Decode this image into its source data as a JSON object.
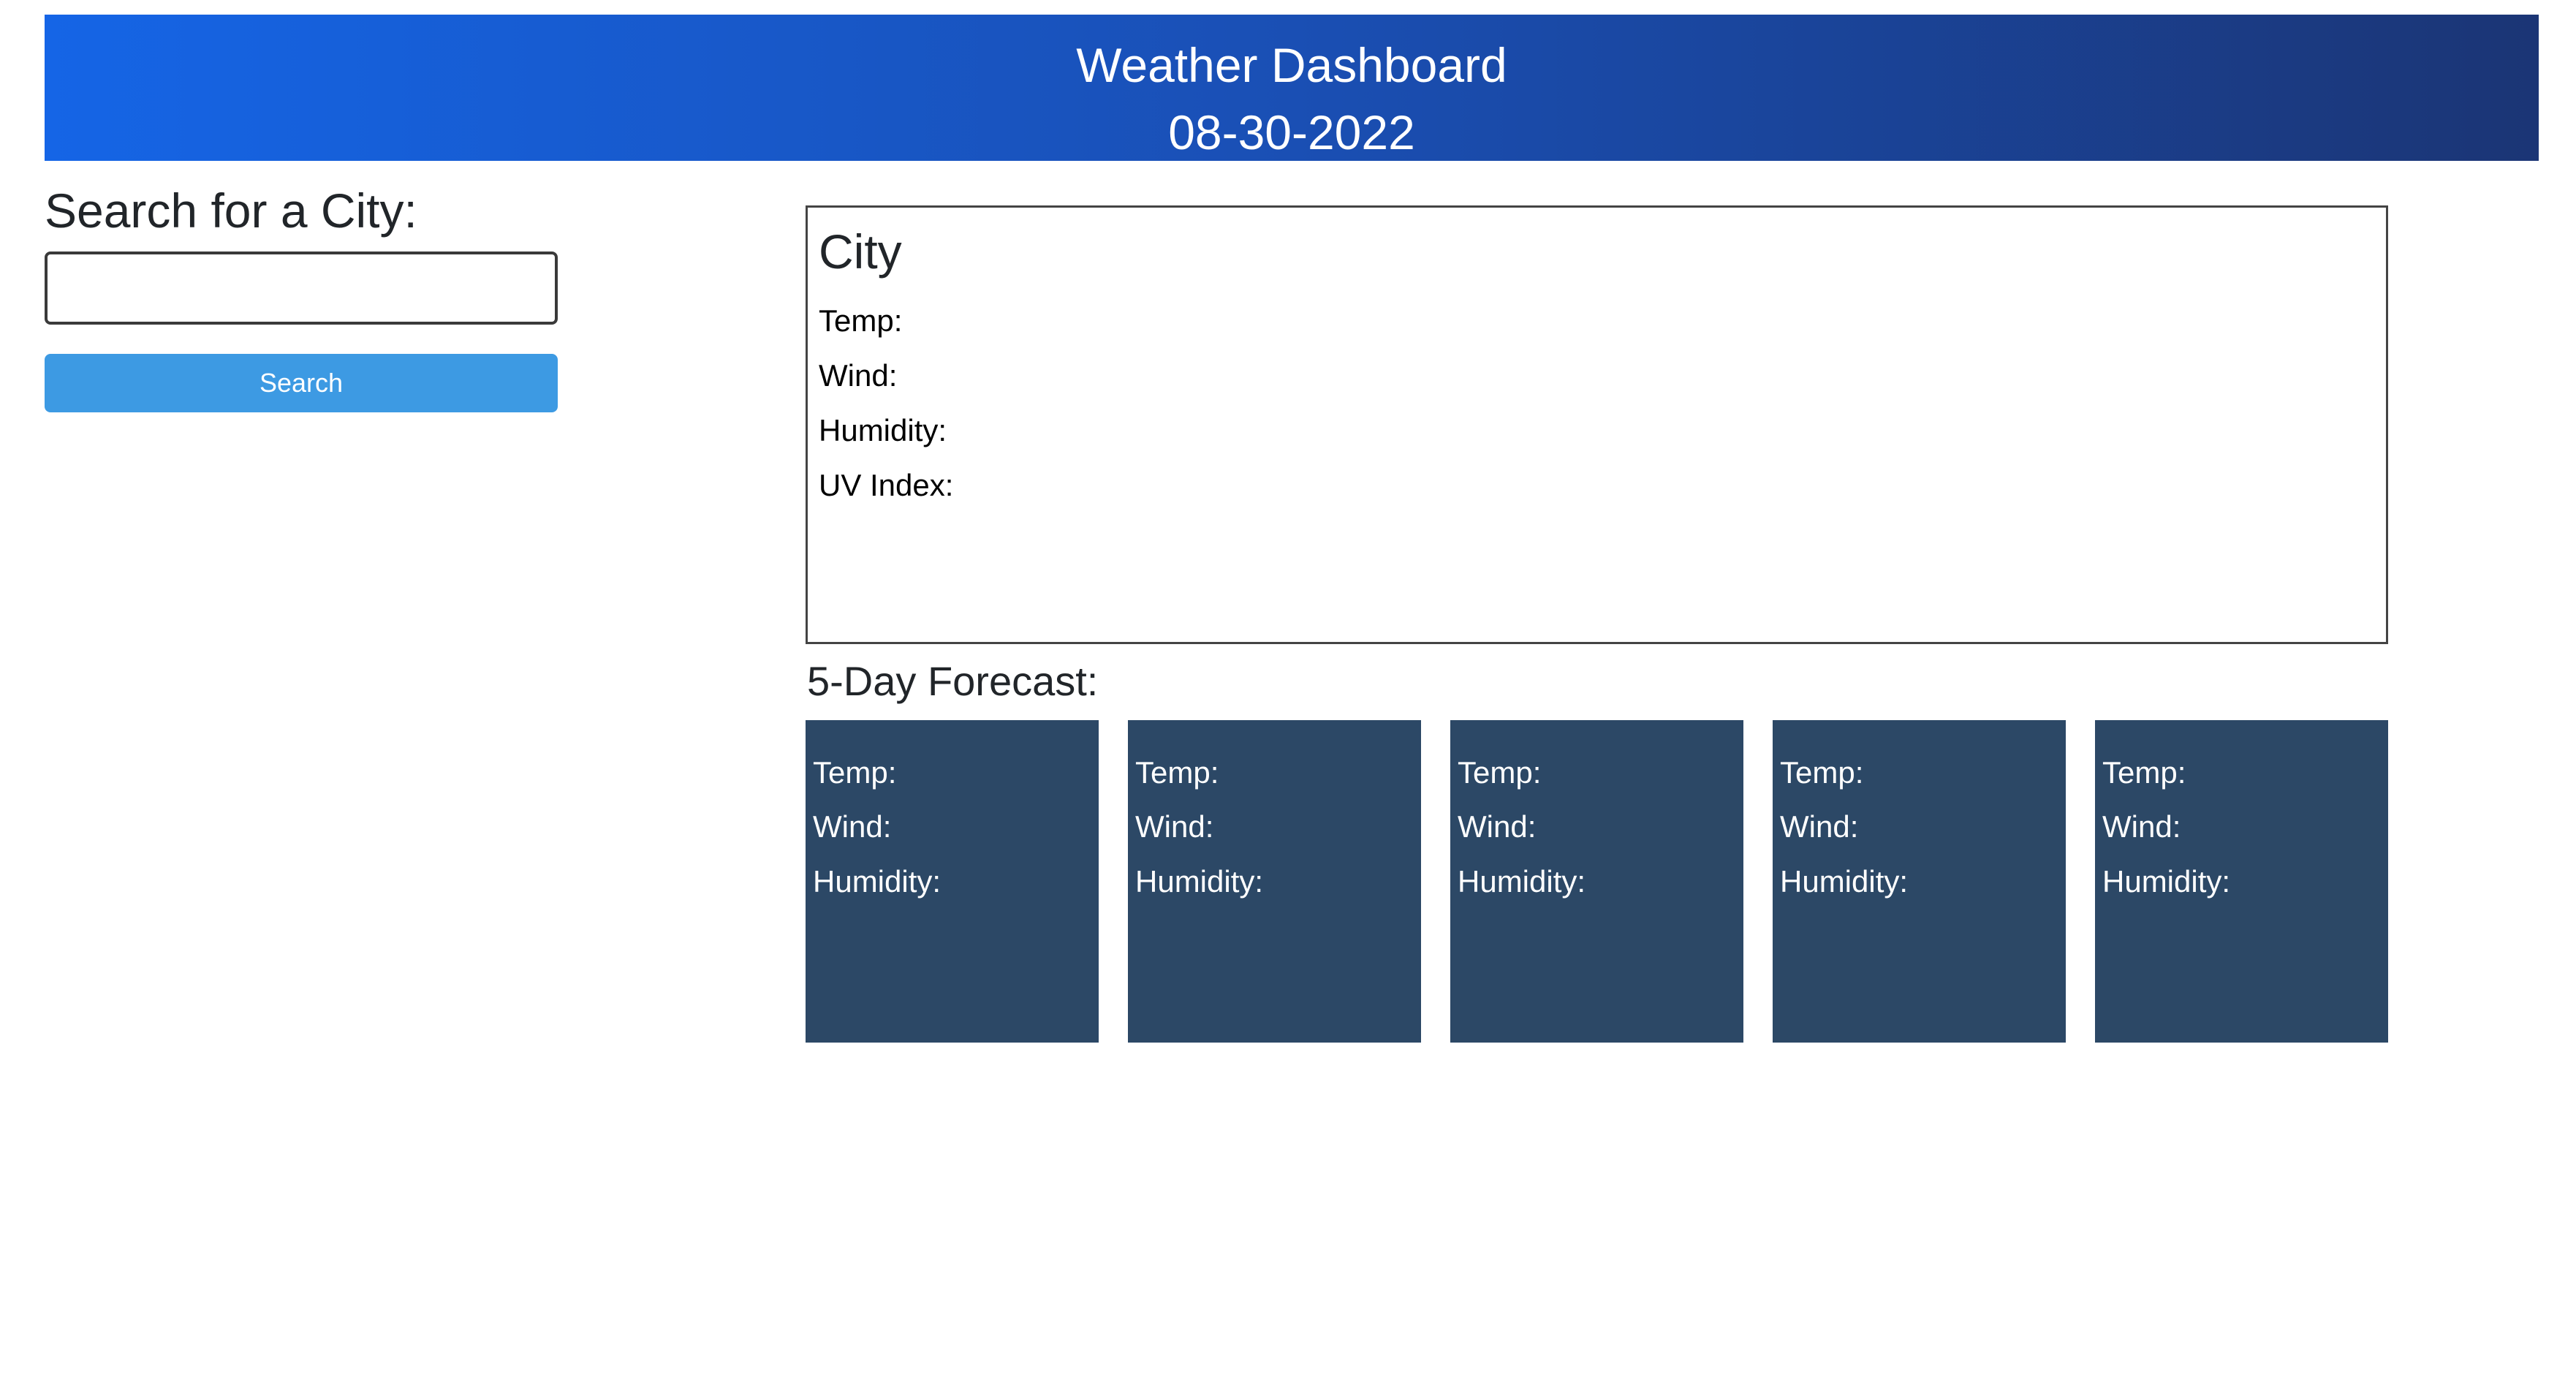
{
  "header": {
    "title": "Weather Dashboard",
    "date": "08-30-2022"
  },
  "search": {
    "heading": "Search for a City:",
    "input_value": "",
    "button_label": "Search"
  },
  "current": {
    "city": "City",
    "temp_label": "Temp:",
    "wind_label": "Wind:",
    "humidity_label": "Humidity:",
    "uv_label": "UV Index:"
  },
  "forecast": {
    "heading": "5-Day Forecast:",
    "days": [
      {
        "temp_label": "Temp:",
        "wind_label": "Wind:",
        "humidity_label": "Humidity:"
      },
      {
        "temp_label": "Temp:",
        "wind_label": "Wind:",
        "humidity_label": "Humidity:"
      },
      {
        "temp_label": "Temp:",
        "wind_label": "Wind:",
        "humidity_label": "Humidity:"
      },
      {
        "temp_label": "Temp:",
        "wind_label": "Wind:",
        "humidity_label": "Humidity:"
      },
      {
        "temp_label": "Temp:",
        "wind_label": "Wind:",
        "humidity_label": "Humidity:"
      }
    ]
  },
  "colors": {
    "header_gradient_start": "#1565e6",
    "header_gradient_end": "#1b3575",
    "search_button": "#3d9ae3",
    "forecast_card": "#2c4866"
  }
}
